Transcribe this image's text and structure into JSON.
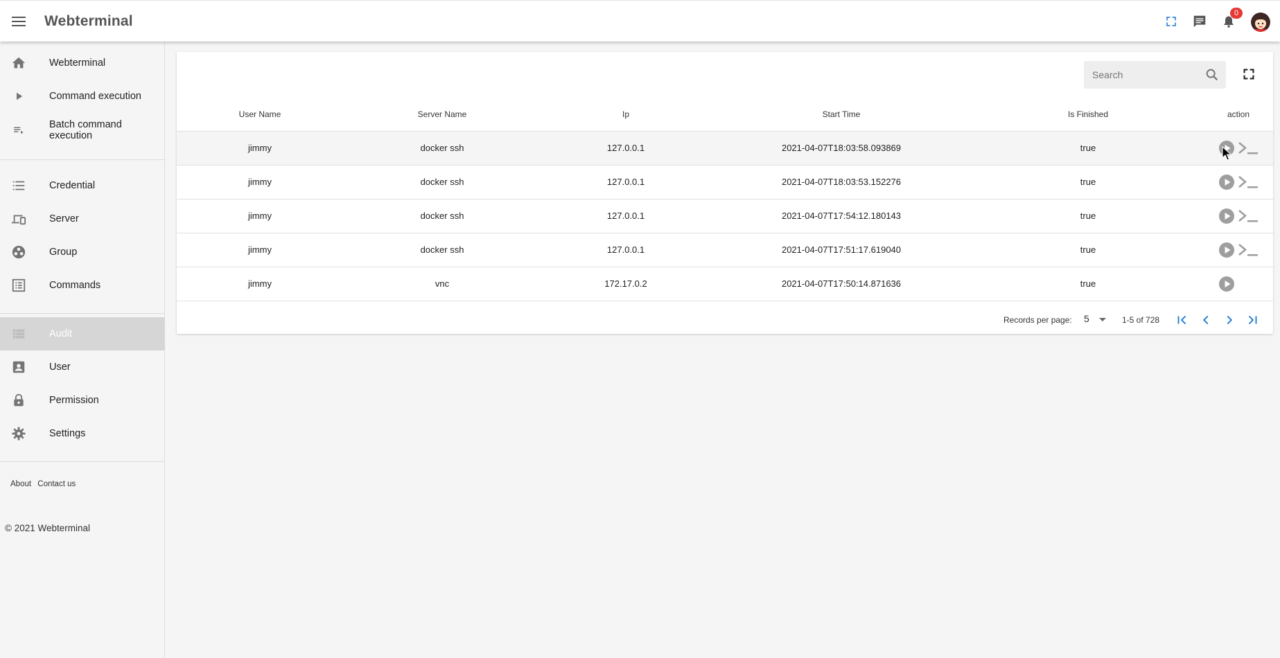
{
  "app": {
    "title": "Webterminal",
    "notification_count": "0"
  },
  "topbar_icons": [
    "fullscreen-icon",
    "chat-icon",
    "bell-icon",
    "avatar"
  ],
  "sidebar": {
    "items": [
      {
        "label": "Webterminal",
        "icon": "home-icon"
      },
      {
        "label": "Command execution",
        "icon": "play-arrow-icon"
      },
      {
        "label": "Batch command execution",
        "icon": "playlist-icon"
      },
      {
        "label": "Credential",
        "icon": "list-icon"
      },
      {
        "label": "Server",
        "icon": "devices-icon"
      },
      {
        "label": "Group",
        "icon": "workspaces-icon"
      },
      {
        "label": "Commands",
        "icon": "list-alt-icon"
      },
      {
        "label": "Audit",
        "icon": "view-list-icon",
        "active": true
      },
      {
        "label": "User",
        "icon": "account-box-icon"
      },
      {
        "label": "Permission",
        "icon": "lock-icon"
      },
      {
        "label": "Settings",
        "icon": "gear-icon"
      }
    ],
    "footer_links": [
      "About",
      "Contact us"
    ],
    "copyright": "© 2021 Webterminal"
  },
  "search": {
    "placeholder": "Search",
    "value": ""
  },
  "table": {
    "columns": [
      "User Name",
      "Server Name",
      "Ip",
      "Start Time",
      "Is Finished",
      "action"
    ],
    "rows": [
      {
        "user": "jimmy",
        "server": "docker ssh",
        "ip": "127.0.0.1",
        "start": "2021-04-07T18:03:58.093869",
        "finished": "true",
        "actions": [
          "play",
          "terminal"
        ]
      },
      {
        "user": "jimmy",
        "server": "docker ssh",
        "ip": "127.0.0.1",
        "start": "2021-04-07T18:03:53.152276",
        "finished": "true",
        "actions": [
          "play",
          "terminal"
        ]
      },
      {
        "user": "jimmy",
        "server": "docker ssh",
        "ip": "127.0.0.1",
        "start": "2021-04-07T17:54:12.180143",
        "finished": "true",
        "actions": [
          "play",
          "terminal"
        ]
      },
      {
        "user": "jimmy",
        "server": "docker ssh",
        "ip": "127.0.0.1",
        "start": "2021-04-07T17:51:17.619040",
        "finished": "true",
        "actions": [
          "play",
          "terminal"
        ]
      },
      {
        "user": "jimmy",
        "server": "vnc",
        "ip": "172.17.0.2",
        "start": "2021-04-07T17:50:14.871636",
        "finished": "true",
        "actions": [
          "play"
        ]
      }
    ]
  },
  "pagination": {
    "records_per_page_label": "Records per page:",
    "records_per_page": "5",
    "range": "1-5 of 728"
  },
  "colors": {
    "accent": "#1976d2",
    "badge": "#e53935",
    "active_nav_bg": "#d6d6d6"
  }
}
